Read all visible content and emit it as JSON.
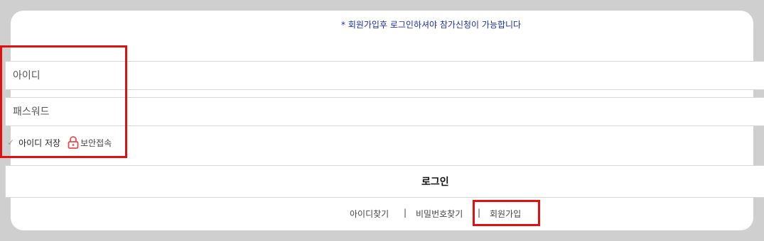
{
  "notice": "* 회원가입후 로그인하셔야 참가신청이 가능합니다",
  "form": {
    "id_placeholder": "아이디",
    "password_placeholder": "패스워드",
    "save_id_label": "아이디 저장",
    "secure_login_label": "보안접속",
    "login_button": "로그인"
  },
  "links": {
    "find_id": "아이디찾기",
    "separator": "|",
    "find_password": "비밀번호찾기",
    "signup": "회원가입"
  },
  "colors": {
    "notice": "#1a2fa8",
    "highlight_box": "#e01010",
    "lock_icon": "#e05050"
  }
}
